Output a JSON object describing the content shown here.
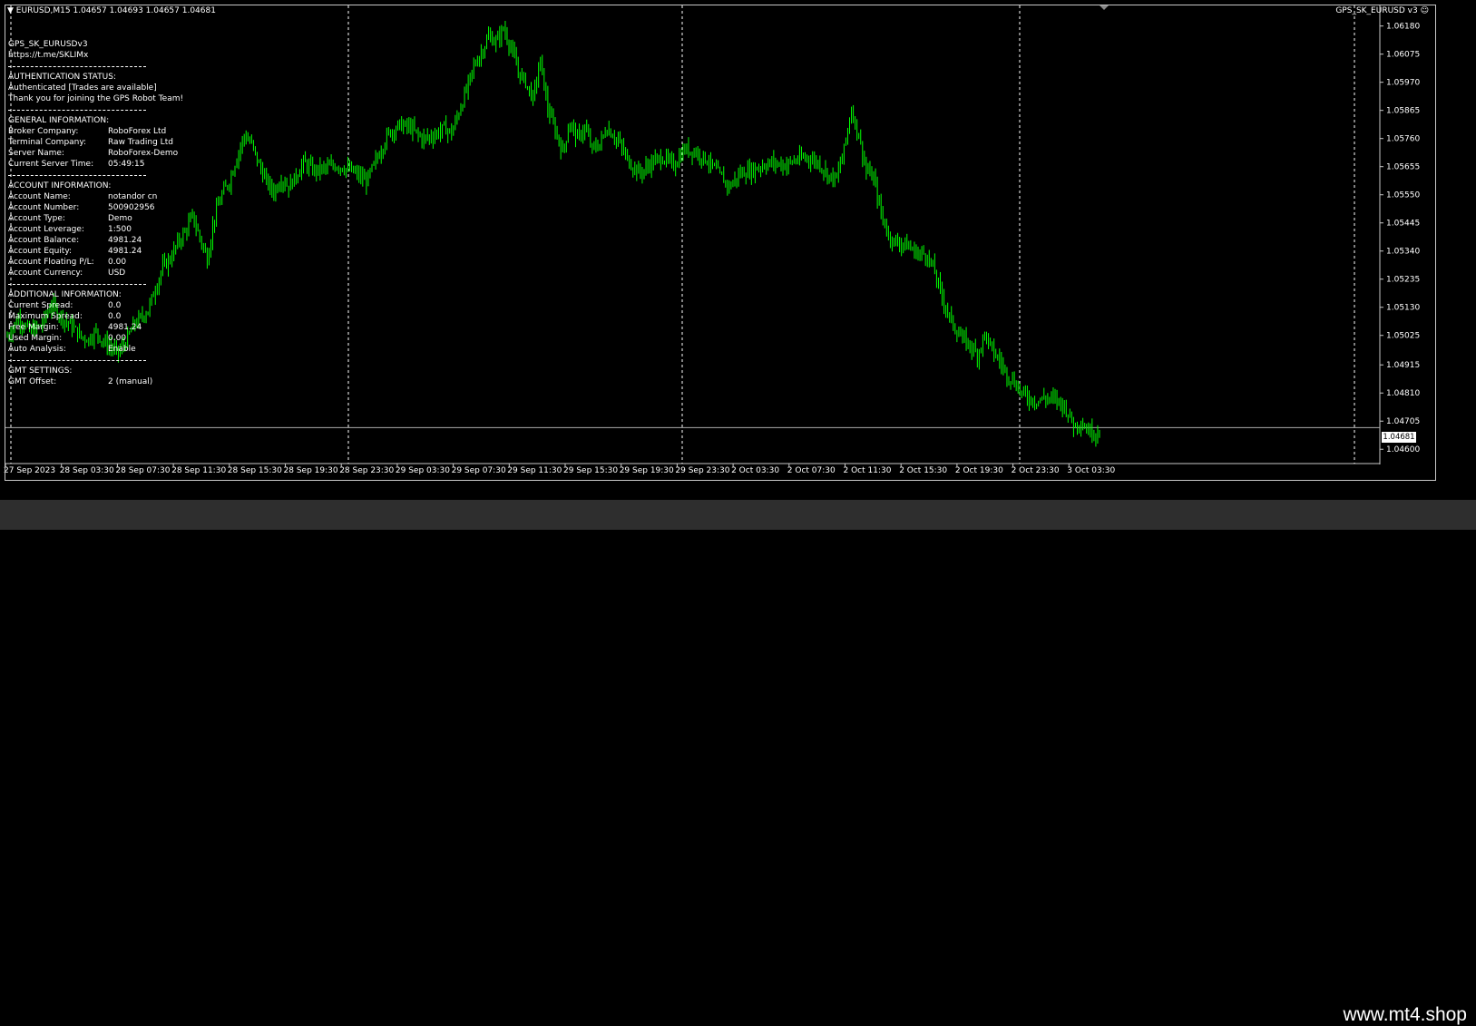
{
  "header": {
    "symbol_info": "EURUSD,M15  1.04657 1.04693 1.04657 1.04681",
    "ea_name": "GPS_SK_EURUSD v3",
    "current_price": "1.04681"
  },
  "panel": {
    "title": "GPS_SK_EURUSDv3",
    "link": "https://t.me/SKLIMx",
    "auth_heading": "AUTHENTICATION STATUS:",
    "auth_status": "Authenticated [Trades are available]",
    "auth_thanks": "Thank you for joining the GPS Robot Team!",
    "general_heading": "GENERAL INFORMATION:",
    "general": [
      {
        "k": "Broker Company:",
        "v": "RoboForex Ltd"
      },
      {
        "k": "Terminal Company:",
        "v": "Raw Trading Ltd"
      },
      {
        "k": "Server Name:",
        "v": "RoboForex-Demo"
      },
      {
        "k": "Current Server Time:",
        "v": "05:49:15"
      }
    ],
    "account_heading": "ACCOUNT INFORMATION:",
    "account": [
      {
        "k": "Account Name:",
        "v": "notandor cn"
      },
      {
        "k": "Account Number:",
        "v": "500902956"
      },
      {
        "k": "Account Type:",
        "v": "Demo"
      },
      {
        "k": "Account Leverage:",
        "v": "1:500"
      },
      {
        "k": "Account Balance:",
        "v": "4981.24"
      },
      {
        "k": "Account Equity:",
        "v": "4981.24"
      },
      {
        "k": "Account Floating P/L:",
        "v": "0.00"
      },
      {
        "k": "Account Currency:",
        "v": "USD"
      }
    ],
    "additional_heading": "ADDITIONAL INFORMATION:",
    "additional": [
      {
        "k": "Current Spread:",
        "v": "0.0"
      },
      {
        "k": "Maximum Spread:",
        "v": "0.0"
      },
      {
        "k": "Free Margin:",
        "v": "4981.24"
      },
      {
        "k": "Used Margin:",
        "v": "0.00"
      },
      {
        "k": "Auto Analysis:",
        "v": "Enable"
      }
    ],
    "gmt_heading": "GMT SETTINGS:",
    "gmt": [
      {
        "k": "GMT Offset:",
        "v": "2 (manual)"
      }
    ]
  },
  "watermark": "www.mt4.shop",
  "chart_data": {
    "type": "candlestick",
    "symbol": "EURUSD",
    "timeframe": "M15",
    "ylim": [
      1.0455,
      1.0625
    ],
    "y_ticks": [
      "1.06180",
      "1.06075",
      "1.05970",
      "1.05865",
      "1.05760",
      "1.05655",
      "1.05550",
      "1.05445",
      "1.05340",
      "1.05235",
      "1.05130",
      "1.05025",
      "1.04915",
      "1.04810",
      "1.04705",
      "1.04600"
    ],
    "x_ticks": [
      "27 Sep 2023",
      "28 Sep 03:30",
      "28 Sep 07:30",
      "28 Sep 11:30",
      "28 Sep 15:30",
      "28 Sep 19:30",
      "28 Sep 23:30",
      "29 Sep 03:30",
      "29 Sep 07:30",
      "29 Sep 11:30",
      "29 Sep 15:30",
      "29 Sep 19:30",
      "29 Sep 23:30",
      "2 Oct 03:30",
      "2 Oct 07:30",
      "2 Oct 11:30",
      "2 Oct 15:30",
      "2 Oct 19:30",
      "2 Oct 23:30",
      "3 Oct 03:30"
    ],
    "close_path": [
      [
        0,
        1.0502
      ],
      [
        6,
        1.0509
      ],
      [
        12,
        1.0504
      ],
      [
        18,
        1.0506
      ],
      [
        24,
        1.0514
      ],
      [
        30,
        1.0509
      ],
      [
        36,
        1.0505
      ],
      [
        40,
        1.0502
      ],
      [
        44,
        1.0501
      ],
      [
        48,
        1.0504
      ],
      [
        52,
        1.05
      ],
      [
        56,
        1.0498
      ],
      [
        60,
        1.0496
      ],
      [
        64,
        1.05
      ],
      [
        68,
        1.0506
      ],
      [
        72,
        1.0509
      ],
      [
        76,
        1.0512
      ],
      [
        80,
        1.052
      ],
      [
        84,
        1.0528
      ],
      [
        88,
        1.0531
      ],
      [
        92,
        1.0537
      ],
      [
        96,
        1.0541
      ],
      [
        100,
        1.0547
      ],
      [
        104,
        1.0539
      ],
      [
        108,
        1.0531
      ],
      [
        112,
        1.0547
      ],
      [
        116,
        1.0555
      ],
      [
        120,
        1.056
      ],
      [
        124,
        1.0569
      ],
      [
        128,
        1.0577
      ],
      [
        132,
        1.0574
      ],
      [
        136,
        1.0566
      ],
      [
        140,
        1.056
      ],
      [
        144,
        1.0556
      ],
      [
        148,
        1.0561
      ],
      [
        152,
        1.0558
      ],
      [
        156,
        1.0562
      ],
      [
        160,
        1.0567
      ],
      [
        166,
        1.0564
      ],
      [
        172,
        1.0565
      ],
      [
        178,
        1.0566
      ],
      [
        186,
        1.0564
      ],
      [
        194,
        1.056
      ],
      [
        200,
        1.0569
      ],
      [
        206,
        1.0578
      ],
      [
        212,
        1.0581
      ],
      [
        218,
        1.058
      ],
      [
        224,
        1.0576
      ],
      [
        230,
        1.0577
      ],
      [
        236,
        1.058
      ],
      [
        240,
        1.0578
      ],
      [
        244,
        1.0586
      ],
      [
        248,
        1.0594
      ],
      [
        252,
        1.0603
      ],
      [
        256,
        1.0608
      ],
      [
        260,
        1.0614
      ],
      [
        264,
        1.0612
      ],
      [
        268,
        1.0617
      ],
      [
        272,
        1.061
      ],
      [
        276,
        1.0601
      ],
      [
        280,
        1.0597
      ],
      [
        284,
        1.0591
      ],
      [
        288,
        1.0605
      ],
      [
        292,
        1.0587
      ],
      [
        296,
        1.0579
      ],
      [
        300,
        1.0571
      ],
      [
        304,
        1.0582
      ],
      [
        308,
        1.0576
      ],
      [
        312,
        1.058
      ],
      [
        316,
        1.0572
      ],
      [
        320,
        1.0574
      ],
      [
        324,
        1.058
      ],
      [
        330,
        1.0575
      ],
      [
        336,
        1.0567
      ],
      [
        342,
        1.0563
      ],
      [
        348,
        1.0567
      ],
      [
        354,
        1.0569
      ],
      [
        360,
        1.0566
      ],
      [
        366,
        1.0572
      ],
      [
        372,
        1.0571
      ],
      [
        378,
        1.0568
      ],
      [
        384,
        1.0563
      ],
      [
        390,
        1.0558
      ],
      [
        396,
        1.0563
      ],
      [
        402,
        1.0564
      ],
      [
        408,
        1.0566
      ],
      [
        414,
        1.0567
      ],
      [
        420,
        1.0566
      ],
      [
        426,
        1.0568
      ],
      [
        432,
        1.0569
      ],
      [
        438,
        1.0567
      ],
      [
        444,
        1.0562
      ],
      [
        448,
        1.0561
      ],
      [
        452,
        1.0572
      ],
      [
        456,
        1.0587
      ],
      [
        460,
        1.0577
      ],
      [
        464,
        1.0564
      ],
      [
        468,
        1.0561
      ],
      [
        472,
        1.0548
      ],
      [
        476,
        1.054
      ],
      [
        480,
        1.0537
      ],
      [
        484,
        1.0537
      ],
      [
        488,
        1.0535
      ],
      [
        492,
        1.0533
      ],
      [
        496,
        1.0533
      ],
      [
        500,
        1.0528
      ],
      [
        504,
        1.0519
      ],
      [
        508,
        1.0511
      ],
      [
        512,
        1.0505
      ],
      [
        516,
        1.0501
      ],
      [
        520,
        1.0499
      ],
      [
        524,
        1.0495
      ],
      [
        528,
        1.0503
      ],
      [
        532,
        1.0497
      ],
      [
        536,
        1.0493
      ],
      [
        540,
        1.0488
      ],
      [
        544,
        1.0485
      ],
      [
        548,
        1.0481
      ],
      [
        552,
        1.0479
      ],
      [
        556,
        1.0478
      ],
      [
        560,
        1.0479
      ],
      [
        564,
        1.0479
      ],
      [
        568,
        1.0478
      ],
      [
        572,
        1.0475
      ],
      [
        576,
        1.0469
      ],
      [
        580,
        1.047
      ],
      [
        584,
        1.0467
      ],
      [
        588,
        1.0466
      ],
      [
        590,
        1.0468
      ]
    ],
    "current_price": 1.04681
  },
  "colors": {
    "background": "#000000",
    "candle": "#00ff00",
    "grid_separator": "#ffffff",
    "frame": "#c8c8c8",
    "text": "#ffffff"
  }
}
